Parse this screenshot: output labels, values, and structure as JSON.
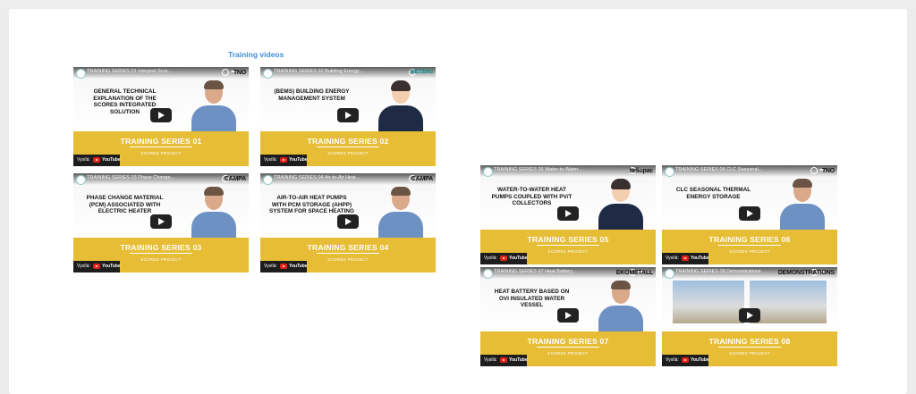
{
  "section_title": "Training videos",
  "videos": [
    {
      "yt_title": "TRAINING SERIES 01 Interpret Scor...",
      "brand": "TNO",
      "headline": "General technical explanation of the SCORES integrated solution",
      "series": "TRAINING SERIES 01",
      "project": "SCORES PROJECT",
      "watch_label": "Vysílá:",
      "youtube": "YouTube"
    },
    {
      "yt_title": "TRAINING SERIES 02 Building Energy...",
      "brand": "SIEMENS",
      "headline": "(BEMS) Building energy management system",
      "series": "TRAINING SERIES 02",
      "project": "SCORES PROJECT",
      "watch_label": "Vysílá:",
      "youtube": "YouTube"
    },
    {
      "yt_title": "TRAINING SERIES 03 Phase Change...",
      "brand": "CAMPA",
      "headline": "Phase change material (PCM) associated with electric heater",
      "series": "TRAINING SERIES 03",
      "project": "SCORES PROJECT",
      "watch_label": "Vysílá:",
      "youtube": "YouTube"
    },
    {
      "yt_title": "TRAINING SERIES 04 Air-to-Air Heat...",
      "brand": "CAMPA",
      "headline": "Air-to-air heat pumps with PCM storage (AHPP) system for space heating",
      "series": "TRAINING SERIES 04",
      "project": "SCORES PROJECT",
      "watch_label": "Vysílá:",
      "youtube": "YouTube"
    },
    {
      "yt_title": "TRAINING SERIES 05 Water-to-Water...",
      "brand": "heliopac",
      "headline": "Water-to-water heat pumps coupled with PV/T collectors",
      "series": "TRAINING SERIES 05",
      "project": "SCORES PROJECT",
      "watch_label": "Vysílá:",
      "youtube": "YouTube"
    },
    {
      "yt_title": "TRAINING SERIES 06 CLC Seasonal...",
      "brand": "TNO",
      "headline": "CLC seasonal thermal energy storage",
      "series": "TRAINING SERIES 06",
      "project": "SCORES PROJECT",
      "watch_label": "Vysílá:",
      "youtube": "YouTube"
    },
    {
      "yt_title": "TRAINING SERIES 07 Heat Battery...",
      "brand": "EKOMETALL",
      "headline": "Heat battery based on OVI insulated water vessel",
      "series": "TRAINING SERIES 07",
      "project": "SCORES PROJECT",
      "watch_label": "Vysílá:",
      "youtube": "YouTube"
    },
    {
      "yt_title": "TRAINING SERIES 08 Demonstrations",
      "brand": "DEMONSTRATIONS",
      "headline": "",
      "series": "TRAINING SERIES 08",
      "project": "SCORES PROJECT",
      "watch_label": "Vysílá:",
      "youtube": "YouTube"
    }
  ],
  "colors": {
    "card_yellow": "#e6bd35",
    "title_blue": "#3f8fd6"
  }
}
